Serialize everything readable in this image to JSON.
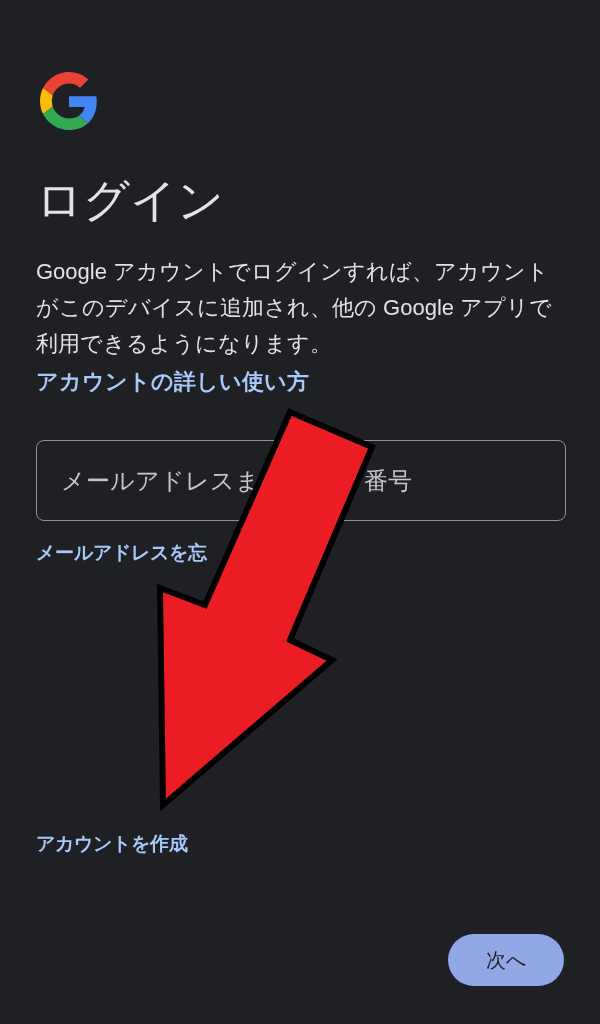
{
  "title": "ログイン",
  "description": "Google アカウントでログインすれば、アカウントがこのデバイスに追加され、他の Google アプリで利用できるようになります。",
  "help_link": "アカウントの詳しい使い方",
  "email_field": {
    "placeholder_parts": [
      "メールアドレスま",
      "番号"
    ]
  },
  "forgot_link": "メールアドレスを忘",
  "create_link": "アカウントを作成",
  "next_button": {
    "label": "次へ"
  }
}
